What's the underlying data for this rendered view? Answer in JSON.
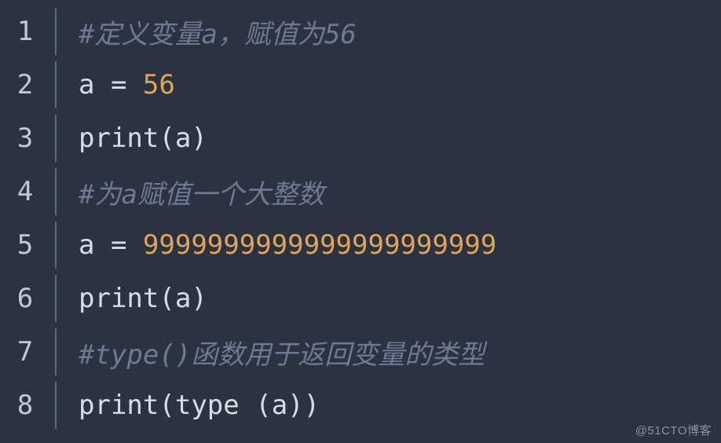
{
  "watermark": "@51CTO博客",
  "lines": [
    {
      "n": "1",
      "tokens": [
        {
          "cls": "tok-comment",
          "t": "#定义变量a，赋值为56"
        }
      ]
    },
    {
      "n": "2",
      "tokens": [
        {
          "cls": "tok-ident",
          "t": "a "
        },
        {
          "cls": "tok-op",
          "t": "= "
        },
        {
          "cls": "tok-number",
          "t": "56"
        }
      ]
    },
    {
      "n": "3",
      "tokens": [
        {
          "cls": "tok-ident",
          "t": "print"
        },
        {
          "cls": "tok-punct",
          "t": "("
        },
        {
          "cls": "tok-ident",
          "t": "a"
        },
        {
          "cls": "tok-punct",
          "t": ")"
        }
      ]
    },
    {
      "n": "4",
      "tokens": [
        {
          "cls": "tok-comment",
          "t": "#为a赋值一个大整数"
        }
      ]
    },
    {
      "n": "5",
      "tokens": [
        {
          "cls": "tok-ident",
          "t": "a "
        },
        {
          "cls": "tok-op",
          "t": "= "
        },
        {
          "cls": "tok-number",
          "t": "9999999999999999999999"
        }
      ]
    },
    {
      "n": "6",
      "tokens": [
        {
          "cls": "tok-ident",
          "t": "print"
        },
        {
          "cls": "tok-punct",
          "t": "("
        },
        {
          "cls": "tok-ident",
          "t": "a"
        },
        {
          "cls": "tok-punct",
          "t": ")"
        }
      ]
    },
    {
      "n": "7",
      "tokens": [
        {
          "cls": "tok-comment",
          "t": "#type()函数用于返回变量的类型"
        }
      ]
    },
    {
      "n": "8",
      "tokens": [
        {
          "cls": "tok-ident",
          "t": "print"
        },
        {
          "cls": "tok-punct",
          "t": "("
        },
        {
          "cls": "tok-ident",
          "t": "type "
        },
        {
          "cls": "tok-punct",
          "t": "("
        },
        {
          "cls": "tok-ident",
          "t": "a"
        },
        {
          "cls": "tok-punct",
          "t": "))"
        }
      ]
    }
  ]
}
